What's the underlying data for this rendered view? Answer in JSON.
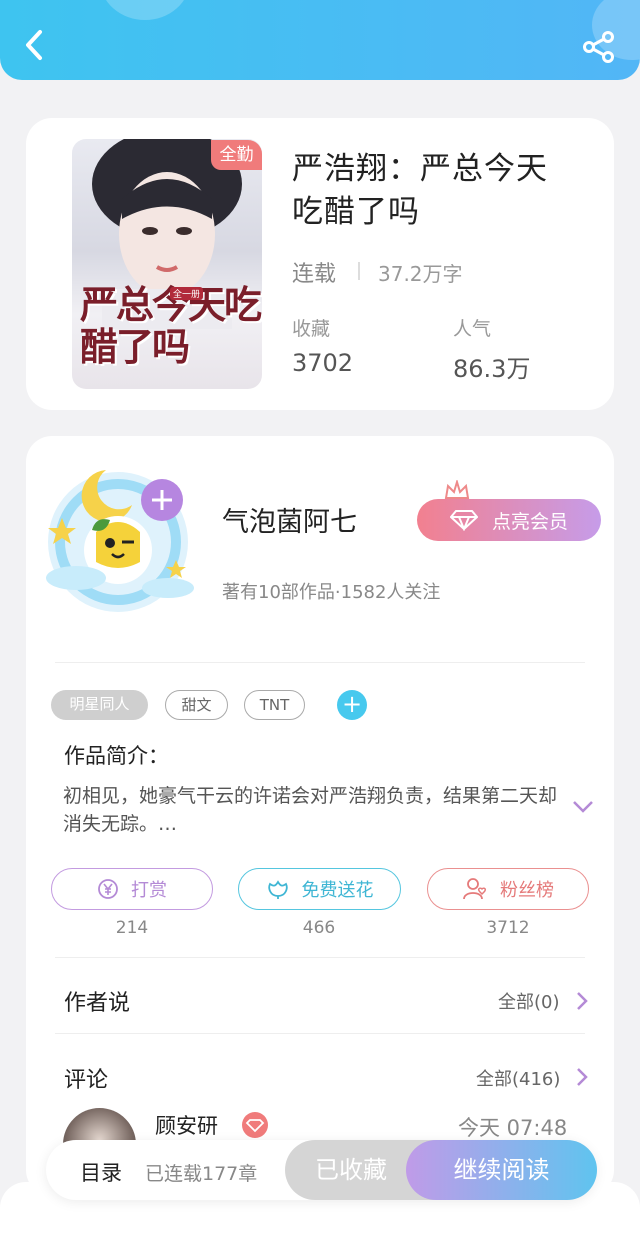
{
  "colors": {
    "header": "#46c0f2",
    "accent_blue": "#47c9ee",
    "vip_gradient": [
      "#f2808f",
      "#c69ce9"
    ],
    "read_gradient": [
      "#c09be8",
      "#5fc4ef"
    ]
  },
  "header": {
    "back_icon": "chevron-left-icon",
    "share_icon": "share-icon"
  },
  "book": {
    "badge": "全勤",
    "cover_text": "严总今天吃醋了吗",
    "cover_small": "全一册",
    "title_line1": "严浩翔：严总今天",
    "title_line2": "吃醋了吗",
    "status": "连载",
    "words": "37.2万字",
    "fav_label": "收藏",
    "fav_value": "3702",
    "pop_label": "人气",
    "pop_value": "86.3万"
  },
  "author": {
    "name": "气泡菌阿七",
    "info": "著有10部作品·1582人关注",
    "vip_label": "点亮会员",
    "add_icon": "plus-icon"
  },
  "tags": [
    "明星同人",
    "甜文",
    "TNT"
  ],
  "synopsis": {
    "label": "作品简介：",
    "text": "初相见，她豪气干云的许诺会对严浩翔负责，结果第二天却消失无踪。…"
  },
  "actions": [
    {
      "label": "打赏",
      "icon": "yuan-icon",
      "count": "214"
    },
    {
      "label": "免费送花",
      "icon": "flower-icon",
      "count": "466"
    },
    {
      "label": "粉丝榜",
      "icon": "fans-icon",
      "count": "3712"
    }
  ],
  "author_says": {
    "label": "作者说",
    "all": "全部(0)"
  },
  "comments": {
    "label": "评论",
    "all": "全部(416)",
    "first": {
      "name": "顾安研",
      "time": "今天 07:48"
    }
  },
  "bottom": {
    "directory": "目录",
    "chapters": "已连载177章",
    "saved": "已收藏",
    "read": "继续阅读"
  }
}
